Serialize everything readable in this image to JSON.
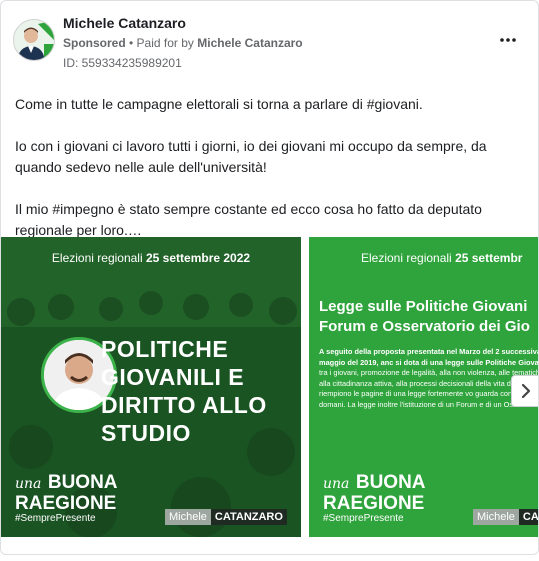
{
  "post": {
    "author": "Michele Catanzaro",
    "sponsored": "Sponsored",
    "paid_prefix": "• Paid for by",
    "payer": "Michele Catanzaro",
    "id_label": "ID: 559334235989201",
    "body": [
      "Come in tutte le campagne elettorali si torna a parlare di #giovani.",
      "Io con i giovani ci lavoro tutti i giorni, io dei giovani mi occupo da sempre, da quando sedevo nelle aule dell'università!",
      "Il mio #impegno è stato sempre costante ed ecco cosa ho fatto da deputato regionale per loro.…"
    ]
  },
  "carousel": {
    "slide1": {
      "elez_prefix": "Elezioni regionali",
      "elez_date": "25 settembre 2022",
      "title": "POLITICHE\nGIOVANILI E\nDIRITTO ALLO\nSTUDIO",
      "brand_una": "una",
      "brand_buona": "BUONA",
      "brand_regione": "RAEGIONE",
      "hashtag": "#SemprePresente",
      "sig_first": "Michele",
      "sig_last": "CATANZARO"
    },
    "slide2": {
      "elez_prefix": "Elezioni regionali",
      "elez_date": "25 settembr",
      "title_line1": "Legge sulle Politiche Giovani",
      "title_line2": "Forum e Osservatorio dei Gio",
      "para_bold": "A seguito della proposta presentata nel Marzo del 2 successiva approvazione nel maggio del 2019, anc si dota di una legge sulle Politiche Giovanili",
      "para_rest": "associazionismo tra i giovani, promozione de legalità, alla non violenza, alle tematiche di discriminazione, alla cittadinanza attiva, alla processi decisionali della vita democratica. Questi t che riempiono le pagine di una legge fortemente vo guarda con fiducia alla Sicilia del domani. La legge inoltre l'istituzione di un Forum e di un Osservatorio",
      "brand_una": "una",
      "brand_buona": "BUONA",
      "brand_regione": "RAEGIONE",
      "hashtag": "#SemprePresente",
      "sig_first": "Michele",
      "sig_last": "CA"
    },
    "next_icon": "chevron-right-icon"
  },
  "colors": {
    "slide1_bg": "#1d5a26",
    "slide2_bg": "#2fa33c",
    "accent_green": "#3cb34a"
  }
}
